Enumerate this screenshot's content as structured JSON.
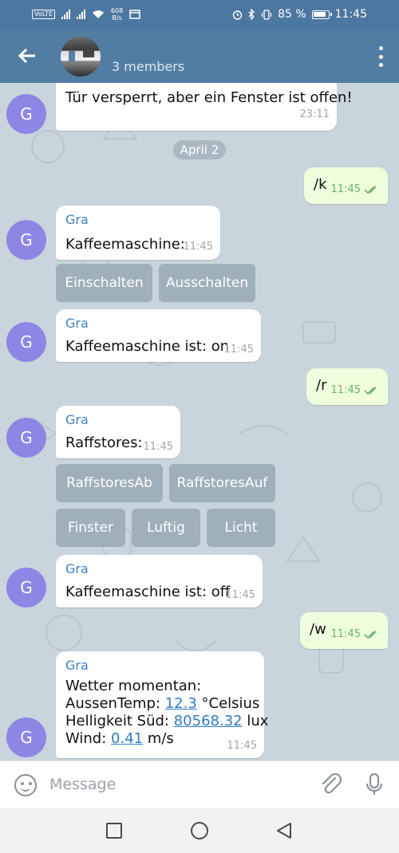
{
  "status_bar": {
    "volte": "VoLTE",
    "net_speed": "608",
    "net_speed_unit": "B/s",
    "battery_percent": "85 %",
    "time": "11:45"
  },
  "header": {
    "members": "3 members"
  },
  "chat": {
    "avatar_initial": "G",
    "date_separator": "April 2",
    "msg_top": {
      "text": "Tür versperrt, aber ein Fenster ist offen!",
      "time": "23:11"
    },
    "out1": {
      "text": "/k",
      "time": "11:45"
    },
    "in1": {
      "sender": "Gra",
      "text": "Kaffeemaschine:",
      "time": "11:45"
    },
    "kb1": [
      "Einschalten",
      "Ausschalten"
    ],
    "in2": {
      "sender": "Gra",
      "text": "Kaffeemaschine ist: on",
      "time": "11:45"
    },
    "out2": {
      "text": "/r",
      "time": "11:45"
    },
    "in3": {
      "sender": "Gra",
      "text": "Raffstores:",
      "time": "11:45"
    },
    "kb2_row1": [
      "RaffstoresAb",
      "RaffstoresAuf"
    ],
    "kb2_row2": [
      "Finster",
      "Luftig",
      "Licht"
    ],
    "in4": {
      "sender": "Gra",
      "text": "Kaffeemaschine ist: off",
      "time": "11:45"
    },
    "out3": {
      "text": "/w",
      "time": "11:45"
    },
    "in5": {
      "sender": "Gra",
      "line1": "Wetter momentan:",
      "line2_prefix": "AussenTemp: ",
      "line2_value": "12.3",
      "line2_suffix": " °Celsius",
      "line3_prefix": "Helligkeit Süd: ",
      "line3_value": "80568.32",
      "line3_suffix": " lux",
      "line4_prefix": "Wind: ",
      "line4_value": "0.41",
      "line4_suffix": " m/s",
      "time": "11:45"
    }
  },
  "input": {
    "placeholder": "Message"
  },
  "colors": {
    "header": "#527da3",
    "chat_bg": "#c9d5dc",
    "avatar": "#8c86e4",
    "out_bubble": "#effedd",
    "link": "#2f7cc2"
  },
  "icons": [
    "back-arrow-icon",
    "more-vert-icon",
    "emoji-icon",
    "attach-icon",
    "mic-icon",
    "double-check-icon"
  ]
}
